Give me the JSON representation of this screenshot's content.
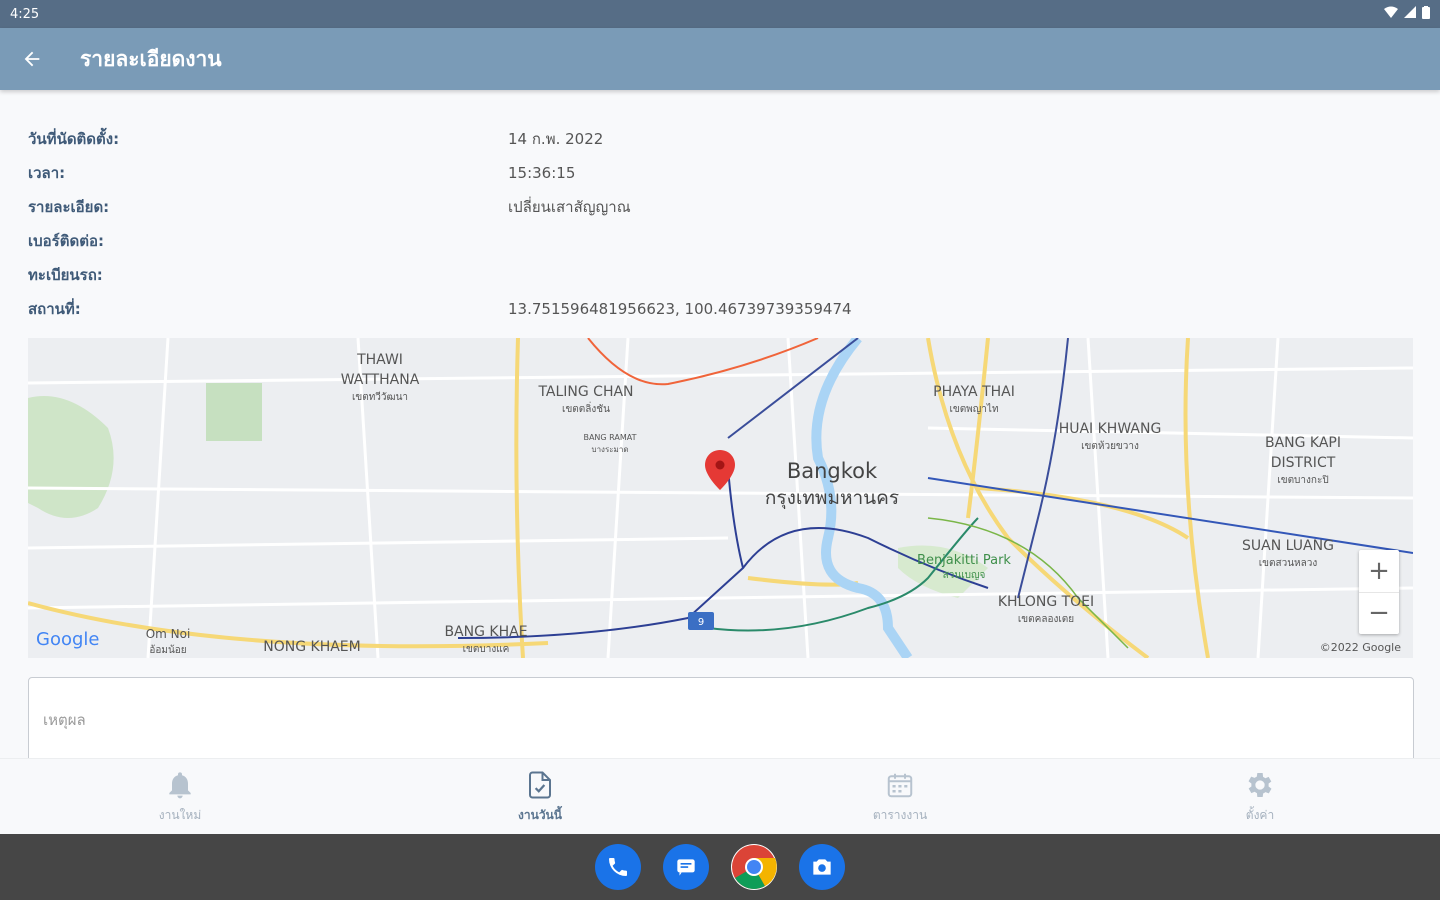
{
  "status_bar": {
    "time": "4:25"
  },
  "header": {
    "title": "รายละเอียดงาน",
    "back_icon": "arrow-left-icon"
  },
  "details": {
    "rows": [
      {
        "label": "วันที่นัดติดตั้ง:",
        "value": "14 ก.พ. 2022"
      },
      {
        "label": "เวลา:",
        "value": "15:36:15"
      },
      {
        "label": "รายละเอียด:",
        "value": "เปลี่ยนเสาสัญญาณ"
      },
      {
        "label": "เบอร์ติดต่อ:",
        "value": ""
      },
      {
        "label": "ทะเบียนรถ:",
        "value": ""
      },
      {
        "label": "สถานที่:",
        "value": "13.751596481956623, 100.46739739359474"
      }
    ]
  },
  "map": {
    "labels": {
      "thawi": "THAWI",
      "watthana": "WATTHANA",
      "thawi_th": "เขตทวีวัฒนา",
      "taling_chan": "TALING CHAN",
      "taling_chan_th": "เขตตลิ่งชัน",
      "bang_ramat": "BANG RAMAT",
      "bang_ramat_th": "บางระมาด",
      "bangkok": "Bangkok",
      "bangkok_th": "กรุงเทพมหานคร",
      "phaya_thai": "PHAYA THAI",
      "phaya_thai_th": "เขตพญาไท",
      "huai_khwang": "HUAI KHWANG",
      "huai_khwang_th": "เขตห้วยขวาง",
      "bang_kapi": "BANG KAPI",
      "district": "DISTRICT",
      "bang_kapi_th": "เขตบางกะปิ",
      "suan_luang": "SUAN LUANG",
      "suan_luang_th": "เขตสวนหลวง",
      "benjakitti": "Benjakitti Park",
      "benjakitti_th": "สวนเบญจ",
      "khlong_toei": "KHLONG TOEI",
      "khlong_toei_th": "เขตคลองเตย",
      "bang_khae": "BANG KHAE",
      "bang_khae_th": "เขตบางแค",
      "nong_khaem": "NONG KHAEM",
      "om_noi": "Om Noi",
      "om_noi_th": "อ้อมน้อย",
      "shield": "9"
    },
    "logo": "Google",
    "copyright": "©2022 Google",
    "zoom_in": "+",
    "zoom_out": "−",
    "marker_icon": "map-pin-icon"
  },
  "reason": {
    "placeholder": "เหตุผล"
  },
  "bottom_nav": [
    {
      "label": "งานใหม่",
      "icon": "bell-icon",
      "active": false
    },
    {
      "label": "งานวันนี้",
      "icon": "file-check-icon",
      "active": true
    },
    {
      "label": "ตารางงาน",
      "icon": "calendar-icon",
      "active": false
    },
    {
      "label": "ตั้งค่า",
      "icon": "gear-icon",
      "active": false
    }
  ],
  "dock": [
    {
      "icon": "phone-icon",
      "color": "#1a73e8"
    },
    {
      "icon": "messages-icon",
      "color": "#1a73e8"
    },
    {
      "icon": "chrome-icon",
      "color": "#34a853"
    },
    {
      "icon": "camera-icon",
      "color": "#1a73e8"
    }
  ],
  "colors": {
    "app_bar": "#7a9bb7",
    "status_bar": "#566d86",
    "label": "#3f5a78",
    "marker": "#e53935"
  }
}
